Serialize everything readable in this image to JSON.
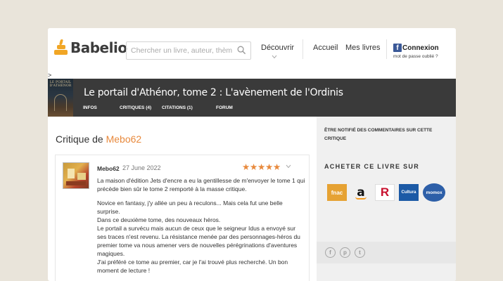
{
  "header": {
    "logo_text": "Babelio",
    "search_placeholder": "Chercher un livre, auteur, thème",
    "nav": {
      "decouvrir": "Découvrir",
      "accueil": "Accueil",
      "mes_livres": "Mes livres"
    },
    "connexion_label": "Connexion",
    "password_forgot": "mot de passe oublié ?",
    "breadcrumb": ">"
  },
  "book": {
    "title": "Le portail d'Athénor, tome 2 : L'avènement de l'Ordinis",
    "cover_text": "LE PORTAIL D'ATHÉNOR",
    "tabs": [
      {
        "label": "INFOS"
      },
      {
        "label": "CRITIQUES (4)"
      },
      {
        "label": "CITATIONS (1)"
      },
      {
        "label": "FORUM"
      }
    ]
  },
  "critique": {
    "heading_prefix": "Critique de",
    "heading_user": "Mebo62",
    "review": {
      "user": "Mebo62",
      "date": "27 June 2022",
      "rating": 5,
      "max_rating": 5,
      "paragraphs": [
        "La maison d'édition Jets d'encre a eu la gentillesse de m'envoyer le tome 1 qui précède bien sûr le tome 2 remporté à la masse critique.",
        "",
        "Novice en fantasy, j'y allée un peu à reculons... Mais cela fut une belle surprise.",
        "Dans ce deuxième tome, des nouveaux héros.",
        "Le portail a survécu mais aucun de ceux que le seigneur Idus a envoyé sur ses traces n'est revenu. La résistance menée par des personnages-héros du premier tome va nous amener vers de nouvelles pérégrinations d'aventures magiques.",
        "J'ai préféré ce tome au premier, car je l'ai trouvé plus recherché. Un bon moment de lecture !"
      ]
    }
  },
  "sidebar": {
    "notify_text": "Être notifié des commentaires sur cette critique",
    "buy_title": "ACHETER CE LIVRE SUR",
    "shops": [
      {
        "name": "fnac",
        "icon": "fnac-logo"
      },
      {
        "name": "a",
        "icon": "amazon-logo"
      },
      {
        "name": "R",
        "icon": "rakuten-logo"
      },
      {
        "name": "Cultura",
        "icon": "cultura-logo"
      },
      {
        "name": "momox",
        "icon": "momox-logo"
      }
    ],
    "social": [
      {
        "icon": "facebook-icon",
        "glyph": "f"
      },
      {
        "icon": "pinterest-icon",
        "glyph": "p"
      },
      {
        "icon": "twitter-icon",
        "glyph": "t"
      }
    ]
  },
  "colors": {
    "accent": "#e8893c",
    "logo": "#f1a625",
    "banner": "#3a3a3a",
    "background": "#e9e4da"
  }
}
